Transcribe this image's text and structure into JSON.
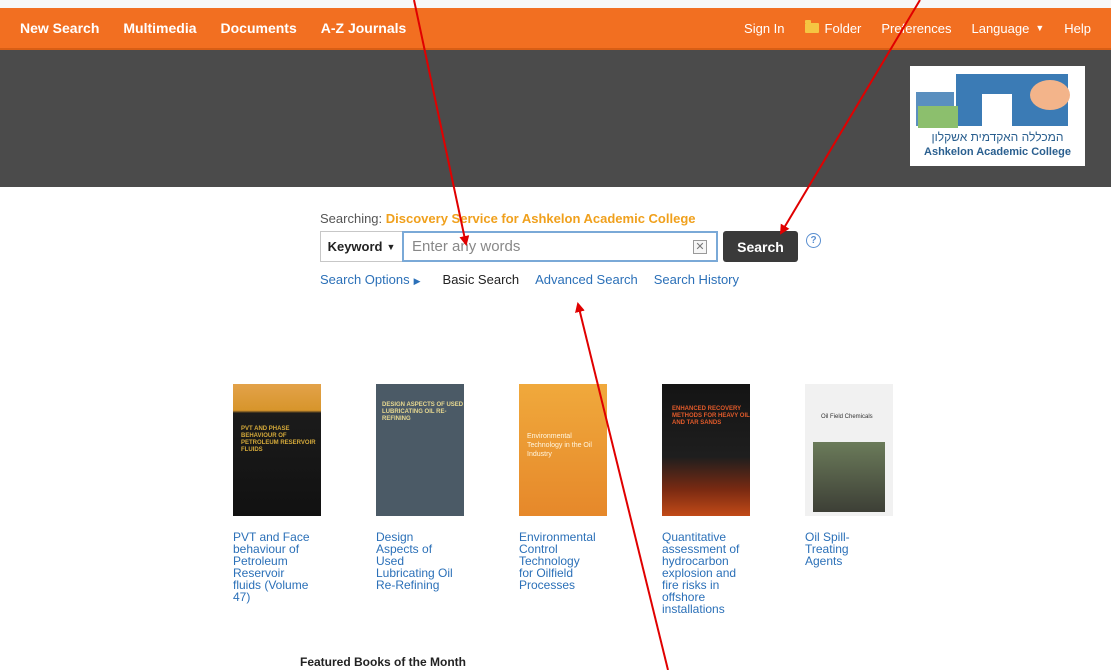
{
  "nav": {
    "left": [
      "New Search",
      "Multimedia",
      "Documents",
      "A-Z Journals"
    ],
    "right": {
      "sign_in": "Sign In",
      "folder": "Folder",
      "preferences": "Preferences",
      "language": "Language",
      "help": "Help"
    },
    "color": "#f26f21"
  },
  "logo": {
    "hebrew": "המכללה האקדמית אשקלון",
    "english": "Ashkelon Academic College"
  },
  "search": {
    "searching_label": "Searching:",
    "profile": "Discovery Service for Ashkelon Academic College",
    "field_type": "Keyword",
    "placeholder": "Enter any words",
    "button": "Search",
    "help": "?",
    "links": {
      "search_options": "Search Options",
      "basic": "Basic Search",
      "advanced": "Advanced Search",
      "history": "Search History"
    }
  },
  "books": [
    {
      "title": "PVT and Face behaviour of Petroleum Reservoir fluids (Volume 47)",
      "cover_text": "PVT AND PHASE BEHAVIOUR OF PETROLEUM RESERVOIR FLUIDS"
    },
    {
      "title": "Design Aspects of Used Lubricating Oil Re-Refining",
      "cover_text": "DESIGN ASPECTS OF USED LUBRICATING OIL RE-REFINING"
    },
    {
      "title": "Environmental Control Technology for Oilfield Processes",
      "cover_text": "Environmental Technology in the Oil Industry"
    },
    {
      "title": "Quantitative assessment of hydrocarbon explosion and fire risks in offshore installations",
      "cover_text": "ENHANCED RECOVERY METHODS FOR HEAVY OIL AND TAR SANDS"
    },
    {
      "title": "Oil Spill-Treating Agents",
      "cover_text": "Oil Field Chemicals"
    }
  ],
  "featured_label": "Featured Books of the Month",
  "annotation_color": "#e00000"
}
